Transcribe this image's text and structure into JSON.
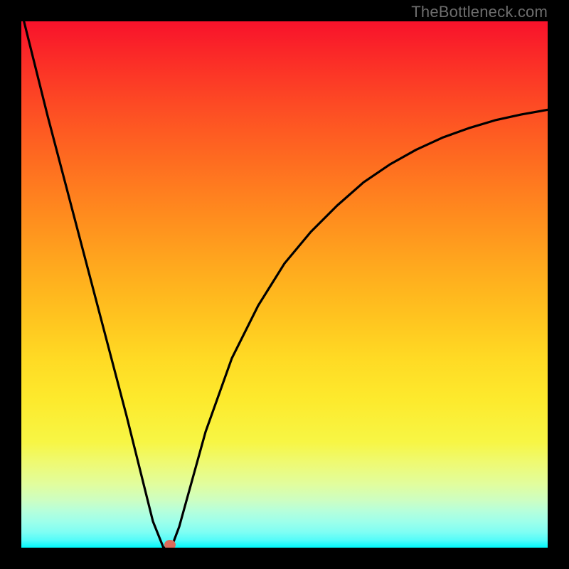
{
  "watermark": "TheBottleneck.com",
  "chart_data": {
    "type": "line",
    "title": "",
    "xlabel": "",
    "ylabel": "",
    "xlim": [
      0,
      1
    ],
    "ylim": [
      0,
      1
    ],
    "grid": false,
    "series": [
      {
        "name": "bottleneck-curve",
        "x": [
          0.005,
          0.05,
          0.1,
          0.15,
          0.2,
          0.23,
          0.25,
          0.27,
          0.285,
          0.3,
          0.325,
          0.35,
          0.4,
          0.45,
          0.5,
          0.55,
          0.6,
          0.65,
          0.7,
          0.75,
          0.8,
          0.85,
          0.9,
          0.95,
          1.0
        ],
        "y": [
          1.0,
          0.82,
          0.63,
          0.44,
          0.25,
          0.13,
          0.05,
          0.0,
          0.0,
          0.04,
          0.13,
          0.22,
          0.36,
          0.46,
          0.54,
          0.6,
          0.65,
          0.694,
          0.728,
          0.756,
          0.779,
          0.797,
          0.812,
          0.823,
          0.832
        ]
      }
    ],
    "annotations": [
      {
        "name": "marker",
        "x": 0.283,
        "y": 0.0,
        "color": "#db6b5b"
      }
    ],
    "background_gradient": {
      "top": "#f8122b",
      "bottom": "#00f8fb"
    }
  }
}
